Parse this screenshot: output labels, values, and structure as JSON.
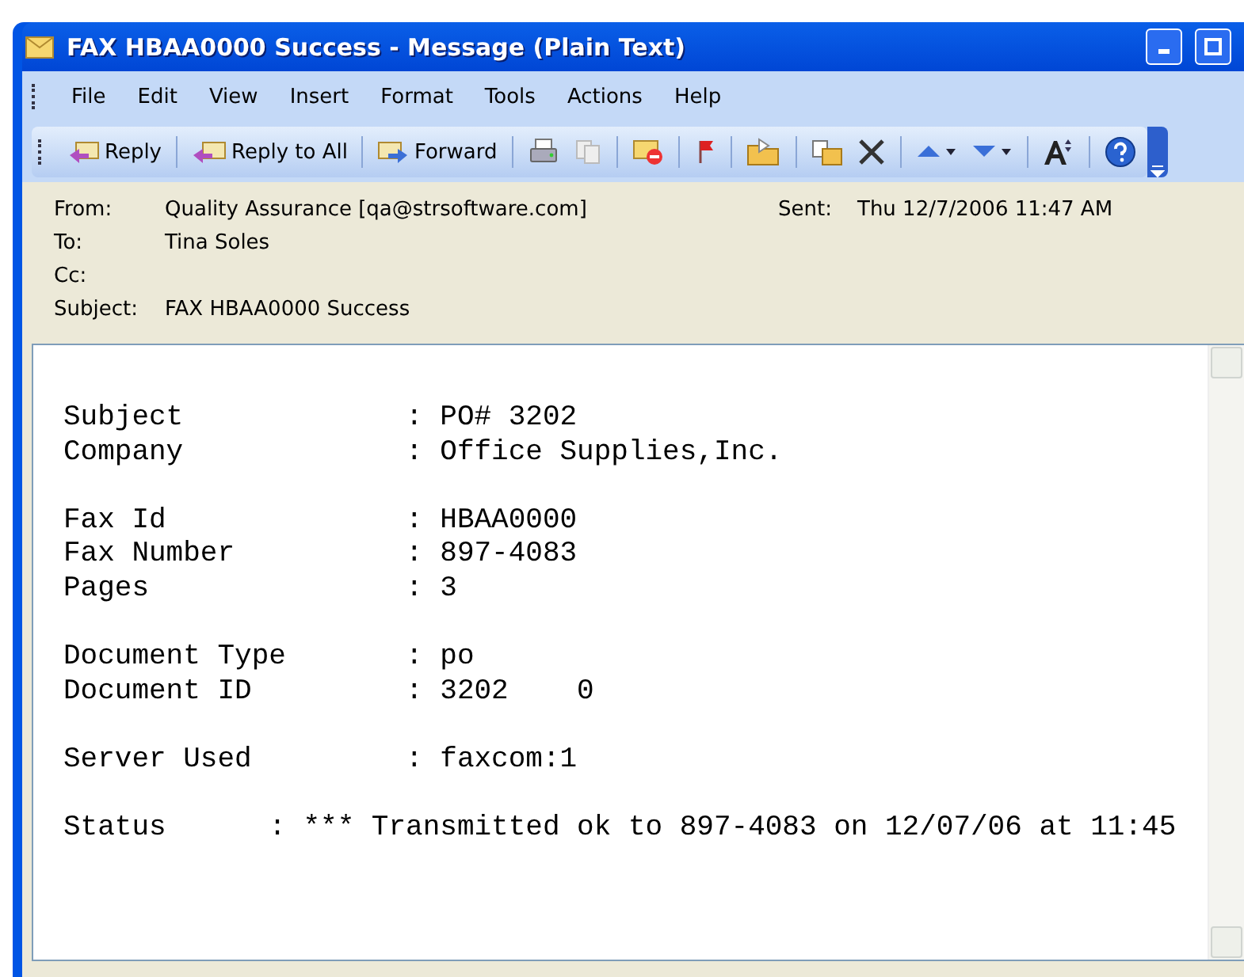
{
  "window": {
    "title": "FAX HBAA0000 Success - Message (Plain Text)"
  },
  "menu": [
    "File",
    "Edit",
    "View",
    "Insert",
    "Format",
    "Tools",
    "Actions",
    "Help"
  ],
  "toolbar": [
    {
      "kind": "labeled",
      "label": "Reply"
    },
    {
      "kind": "labeled",
      "label": "Reply to All"
    },
    {
      "kind": "labeled",
      "label": "Forward"
    },
    {
      "kind": "icon"
    },
    {
      "kind": "icon"
    },
    {
      "kind": "icon"
    },
    {
      "kind": "icon"
    },
    {
      "kind": "icon"
    },
    {
      "kind": "icon"
    },
    {
      "kind": "icon"
    },
    {
      "kind": "icon"
    },
    {
      "kind": "icon"
    },
    {
      "kind": "icon"
    },
    {
      "kind": "icon"
    }
  ],
  "header": {
    "from_label": "From:",
    "from": "Quality Assurance [qa@strsoftware.com]",
    "sent_label": "Sent:",
    "sent": "Thu 12/7/2006 11:47 AM",
    "to_label": "To:",
    "to": "Tina Soles",
    "cc_label": "Cc:",
    "subject_label": "Subject:",
    "subject": "FAX HBAA0000 Success"
  },
  "body": {
    "paragraphs": [
      [
        "Subject             : PO# 3202",
        "Company             : Office Supplies,Inc."
      ],
      [
        "Fax Id              : HBAA0000",
        "Fax Number          : 897-4083",
        "Pages               : 3"
      ],
      [
        "Document Type       : po",
        "Document ID         : 3202    0"
      ],
      [
        "Server Used         : faxcom:1"
      ],
      [
        "Status      : *** Transmitted ok to 897-4083 on 12/07/06 at 11:45"
      ]
    ]
  }
}
